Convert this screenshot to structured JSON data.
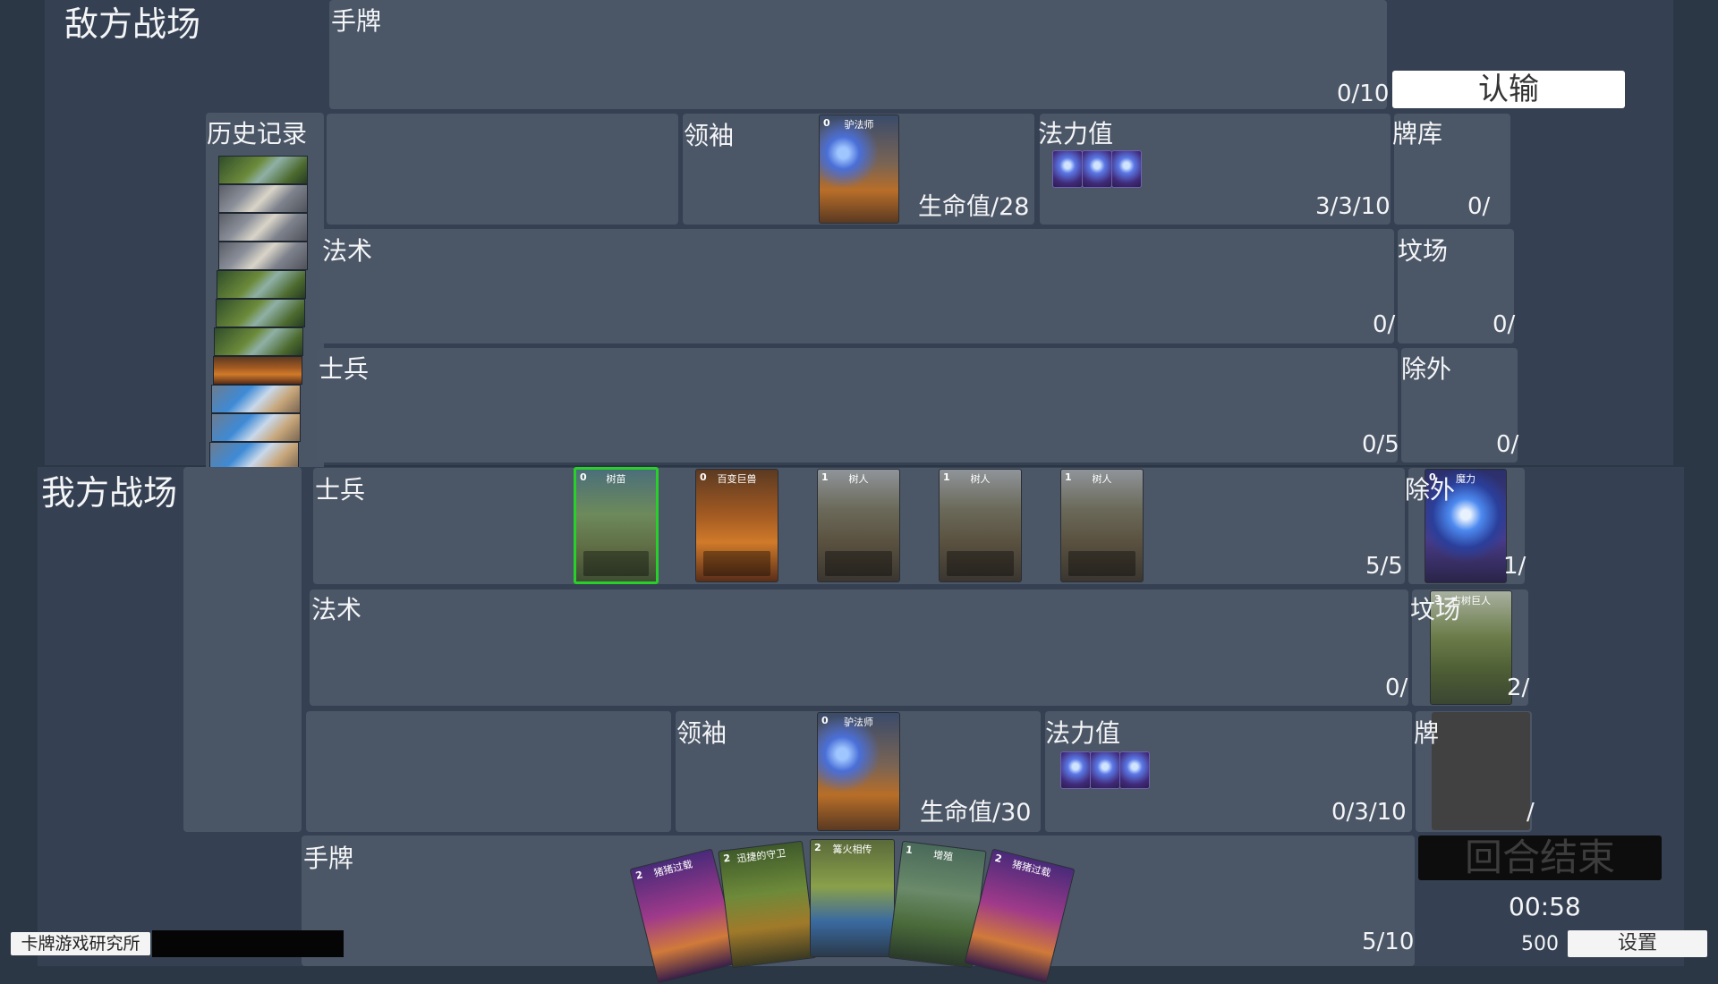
{
  "enemy": {
    "title": "敌方战场",
    "hand_label": "手牌",
    "hand_count": "0/10",
    "leader_label": "领袖",
    "leader_card": {
      "cost": "0",
      "name": "驴法师"
    },
    "health": "生命值/28",
    "mana_label": "法力值",
    "mana_value": "3/3/10",
    "deck_label": "牌库",
    "deck_count": "0/",
    "spell_label": "法术",
    "spell_count": "0/",
    "graveyard_label": "坟场",
    "graveyard_count": "0/",
    "soldier_label": "士兵",
    "soldier_count": "0/5",
    "exile_label": "除外",
    "exile_count": "0/"
  },
  "player": {
    "title": "我方战场",
    "soldier_label": "士兵",
    "soldier_count": "5/5",
    "soldiers": [
      {
        "cost": "0",
        "name": "树苗"
      },
      {
        "cost": "0",
        "name": "百变巨兽"
      },
      {
        "cost": "1",
        "name": "树人"
      },
      {
        "cost": "1",
        "name": "树人"
      },
      {
        "cost": "1",
        "name": "树人"
      }
    ],
    "exile_label": "除外",
    "exile_count": "1/",
    "exile_card": {
      "cost": "0",
      "name": "魔力"
    },
    "spell_label": "法术",
    "spell_count": "0/",
    "graveyard_label": "坟场",
    "graveyard_count": "2/",
    "graveyard_card": {
      "cost": "3",
      "name": "古树巨人"
    },
    "leader_label": "领袖",
    "leader_card": {
      "cost": "0",
      "name": "驴法师"
    },
    "health": "生命值/30",
    "mana_label": "法力值",
    "mana_value": "0/3/10",
    "deck_label": "牌",
    "deck_count": "/",
    "hand_label": "手牌",
    "hand_count": "5/10",
    "hand_cards": [
      {
        "cost": "2",
        "name": "猪猪过载"
      },
      {
        "cost": "2",
        "name": "迅捷的守卫"
      },
      {
        "cost": "2",
        "name": "篝火相传"
      },
      {
        "cost": "1",
        "name": "增殖"
      },
      {
        "cost": "2",
        "name": "猪猪过载"
      }
    ]
  },
  "history_label": "历史记录",
  "surrender_button": "认输",
  "end_turn_button": "回合结束",
  "timer": "00:58",
  "gold": "500",
  "settings_button": "设置",
  "studio_label": "卡牌游戏研究所"
}
